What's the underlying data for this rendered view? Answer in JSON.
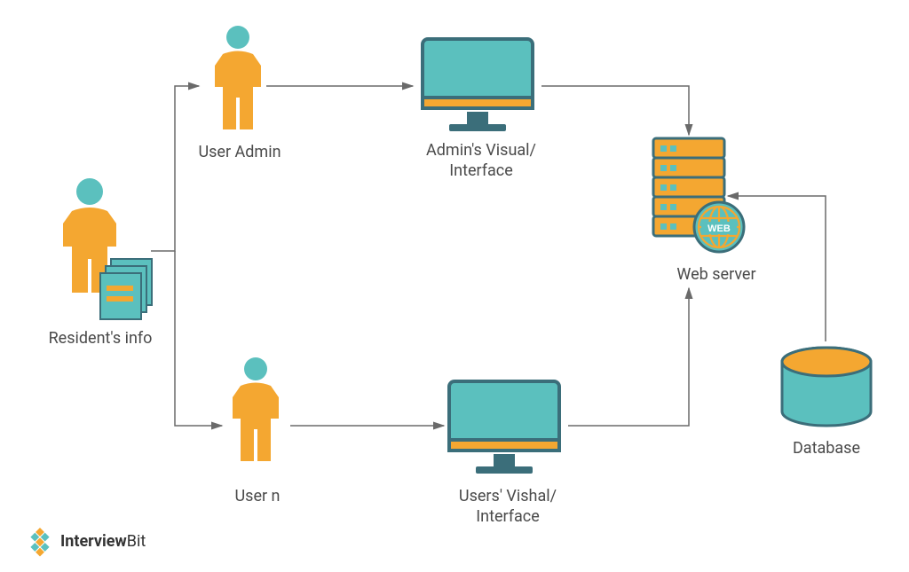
{
  "nodes": {
    "resident_info": {
      "label": "Resident's info"
    },
    "user_admin": {
      "label": "User Admin"
    },
    "user_n": {
      "label": "User n"
    },
    "admin_interface": {
      "label": "Admin's Visual/\nInterface"
    },
    "user_interface": {
      "label": "Users' Vishal/\nInterface"
    },
    "web_server": {
      "label": "Web server",
      "badge": "WEB"
    },
    "database": {
      "label": "Database"
    }
  },
  "brand": {
    "name_bold": "Interview",
    "name_light": "Bit"
  },
  "colors": {
    "accent_orange": "#f4a731",
    "accent_teal": "#5bc0be",
    "outline": "#3b6e7a",
    "text": "#4a4a4a"
  }
}
